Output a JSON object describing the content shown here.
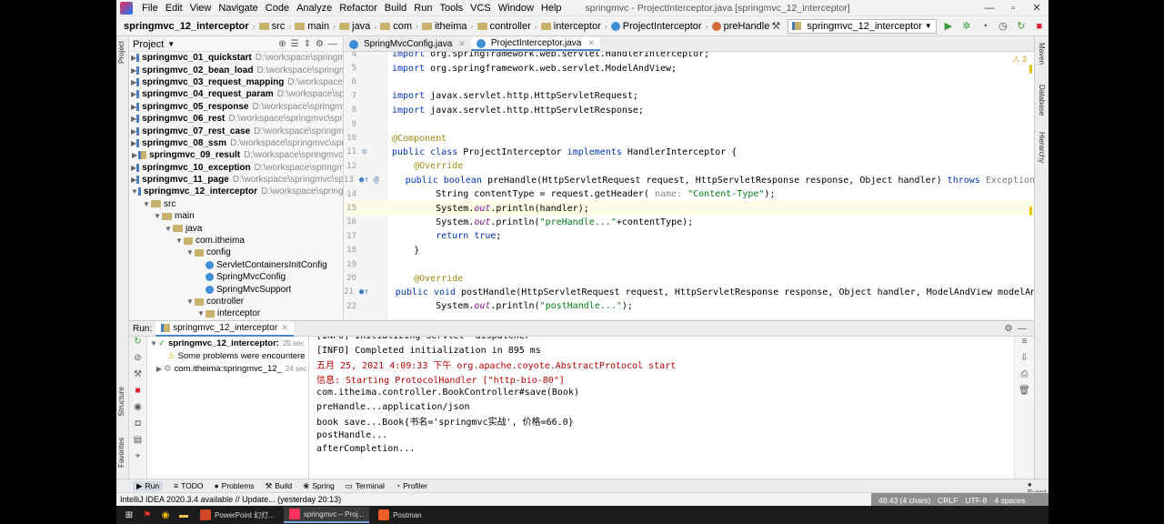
{
  "menu": [
    "File",
    "Edit",
    "View",
    "Navigate",
    "Code",
    "Analyze",
    "Refactor",
    "Build",
    "Run",
    "Tools",
    "VCS",
    "Window",
    "Help"
  ],
  "window_title": "springmvc - ProjectInterceptor.java [springmvc_12_interceptor]",
  "breadcrumbs": [
    "springmvc_12_interceptor",
    "src",
    "main",
    "java",
    "com",
    "itheima",
    "controller",
    "interceptor",
    "ProjectInterceptor",
    "preHandle"
  ],
  "run_config": "springmvc_12_interceptor",
  "project_panel": {
    "title": "Project",
    "modules": [
      {
        "name": "springmvc_01_quickstart",
        "path": "D:\\workspace\\springmvc"
      },
      {
        "name": "springmvc_02_bean_load",
        "path": "D:\\workspace\\springmvc"
      },
      {
        "name": "springmvc_03_request_mapping",
        "path": "D:\\workspace\\s"
      },
      {
        "name": "springmvc_04_request_param",
        "path": "D:\\workspace\\spr"
      },
      {
        "name": "springmvc_05_response",
        "path": "D:\\workspace\\springmv"
      },
      {
        "name": "springmvc_06_rest",
        "path": "D:\\workspace\\springmvc\\sprin"
      },
      {
        "name": "springmvc_07_rest_case",
        "path": "D:\\workspace\\springmv"
      },
      {
        "name": "springmvc_08_ssm",
        "path": "D:\\workspace\\springmvc\\sprin"
      },
      {
        "name": "springmvc_09_result",
        "path": "D:\\workspace\\springmvc"
      },
      {
        "name": "springmvc_10_exception",
        "path": "D:\\workspace\\springmv"
      },
      {
        "name": "springmvc_11_page",
        "path": "D:\\workspace\\springmvc\\spri"
      },
      {
        "name": "springmvc_12_interceptor",
        "path": "D:\\workspace\\springm"
      }
    ],
    "subtree": [
      {
        "label": "src",
        "level": 1,
        "kind": "folder",
        "open": true
      },
      {
        "label": "main",
        "level": 2,
        "kind": "folder",
        "open": true
      },
      {
        "label": "java",
        "level": 3,
        "kind": "folder",
        "open": true
      },
      {
        "label": "com.itheima",
        "level": 4,
        "kind": "package",
        "open": true
      },
      {
        "label": "config",
        "level": 5,
        "kind": "package",
        "open": true
      },
      {
        "label": "ServletContainersInitConfig",
        "level": 6,
        "kind": "class"
      },
      {
        "label": "SpringMvcConfig",
        "level": 6,
        "kind": "class"
      },
      {
        "label": "SpringMvcSupport",
        "level": 6,
        "kind": "class"
      },
      {
        "label": "controller",
        "level": 5,
        "kind": "package",
        "open": true
      },
      {
        "label": "interceptor",
        "level": 6,
        "kind": "package",
        "open": true
      }
    ]
  },
  "editor_tabs": [
    {
      "label": "SpringMvcConfig.java",
      "active": false
    },
    {
      "label": "ProjectInterceptor.java",
      "active": true
    }
  ],
  "warning_count": "3",
  "code_lines": [
    {
      "n": "4",
      "html": "<span class='kw'>import</span> org.springframework.web.servlet.HandlerInterceptor;"
    },
    {
      "n": "5",
      "html": "<span class='kw'>import</span> org.springframework.web.servlet.ModelAndView;"
    },
    {
      "n": "6",
      "html": ""
    },
    {
      "n": "7",
      "html": "<span class='kw'>import</span> javax.servlet.http.HttpServletRequest;"
    },
    {
      "n": "8",
      "html": "<span class='kw'>import</span> javax.servlet.http.HttpServletResponse;"
    },
    {
      "n": "9",
      "html": ""
    },
    {
      "n": "10",
      "html": "<span class='an'>@Component</span>"
    },
    {
      "n": "11",
      "html": "<span class='kw'>public class</span> ProjectInterceptor <span class='kw'>implements</span> HandlerInterceptor {"
    },
    {
      "n": "12",
      "html": "    <span class='an'>@Override</span>"
    },
    {
      "n": "13",
      "html": "    <span class='kw'>public boolean</span> preHandle(HttpServletRequest request, HttpServletResponse response, Object handler) <span class='kw'>throws</span> <span class='gr'>Exception</span> {"
    },
    {
      "n": "14",
      "html": "        String contentType = request.getHeader( <span class='hint'>name:</span> <span class='st'>\"Content-Type\"</span>);"
    },
    {
      "n": "15",
      "html": "        System.<span class='fi'>out</span>.println(handler);"
    },
    {
      "n": "16",
      "html": "        System.<span class='fi'>out</span>.println(<span class='st'>\"preHandle...\"</span>+contentType);"
    },
    {
      "n": "17",
      "html": "        <span class='kw'>return true</span>;"
    },
    {
      "n": "18",
      "html": "    }"
    },
    {
      "n": "19",
      "html": ""
    },
    {
      "n": "20",
      "html": "    <span class='an'>@Override</span>"
    },
    {
      "n": "21",
      "html": "    <span class='kw'>public void</span> postHandle(HttpServletRequest request, HttpServletResponse response, Object handler, ModelAndView modelAn"
    },
    {
      "n": "22",
      "html": "        System.<span class='fi'>out</span>.println(<span class='st'>\"postHandle...\"</span>);"
    }
  ],
  "run_panel": {
    "label": "Run:",
    "tab": "springmvc_12_interceptor",
    "tree": [
      {
        "label": "springmvc_12_interceptor:",
        "time": "25 sec",
        "bold": true
      },
      {
        "label": "Some problems were encountere",
        "time": "",
        "warn": true
      },
      {
        "label": "com.itheima:springmvc_12_",
        "time": "24 sec"
      }
    ],
    "console": [
      {
        "text": "[INFO] Initializing Servlet 'dispatcher'",
        "red": false
      },
      {
        "text": "[INFO] Completed initialization in 895 ms",
        "red": false
      },
      {
        "text": "五月 25, 2021 4:09:33 下午 org.apache.coyote.AbstractProtocol start",
        "red": true
      },
      {
        "text": "信息: Starting ProtocolHandler [\"http-bio-80\"]",
        "red": true
      },
      {
        "text": "com.itheima.controller.BookController#save(Book)",
        "red": false
      },
      {
        "text": "preHandle...application/json",
        "red": false
      },
      {
        "text": "book save...Book{书名='springmvc实战', 价格=66.0}",
        "red": false
      },
      {
        "text": "postHandle...",
        "red": false
      },
      {
        "text": "afterCompletion...",
        "red": false
      }
    ]
  },
  "bottom_tabs": [
    "Run",
    "TODO",
    "Problems",
    "Build",
    "Spring",
    "Terminal",
    "Profiler"
  ],
  "event_log": "Event Log",
  "status_text": "IntelliJ IDEA 2020.3.4 available // Update... (yesterday 20:13)",
  "status_right": [
    "48:43 (4 chars)",
    "CRLF",
    "UTF-8",
    "4 spaces"
  ],
  "taskbar_apps": [
    {
      "label": "PowerPoint 幻灯...",
      "color": "#d24726",
      "active": false
    },
    {
      "label": "springmvc – Proj...",
      "color": "#fe315d",
      "active": true
    },
    {
      "label": "Postman",
      "color": "#ef5b25",
      "active": false
    }
  ]
}
